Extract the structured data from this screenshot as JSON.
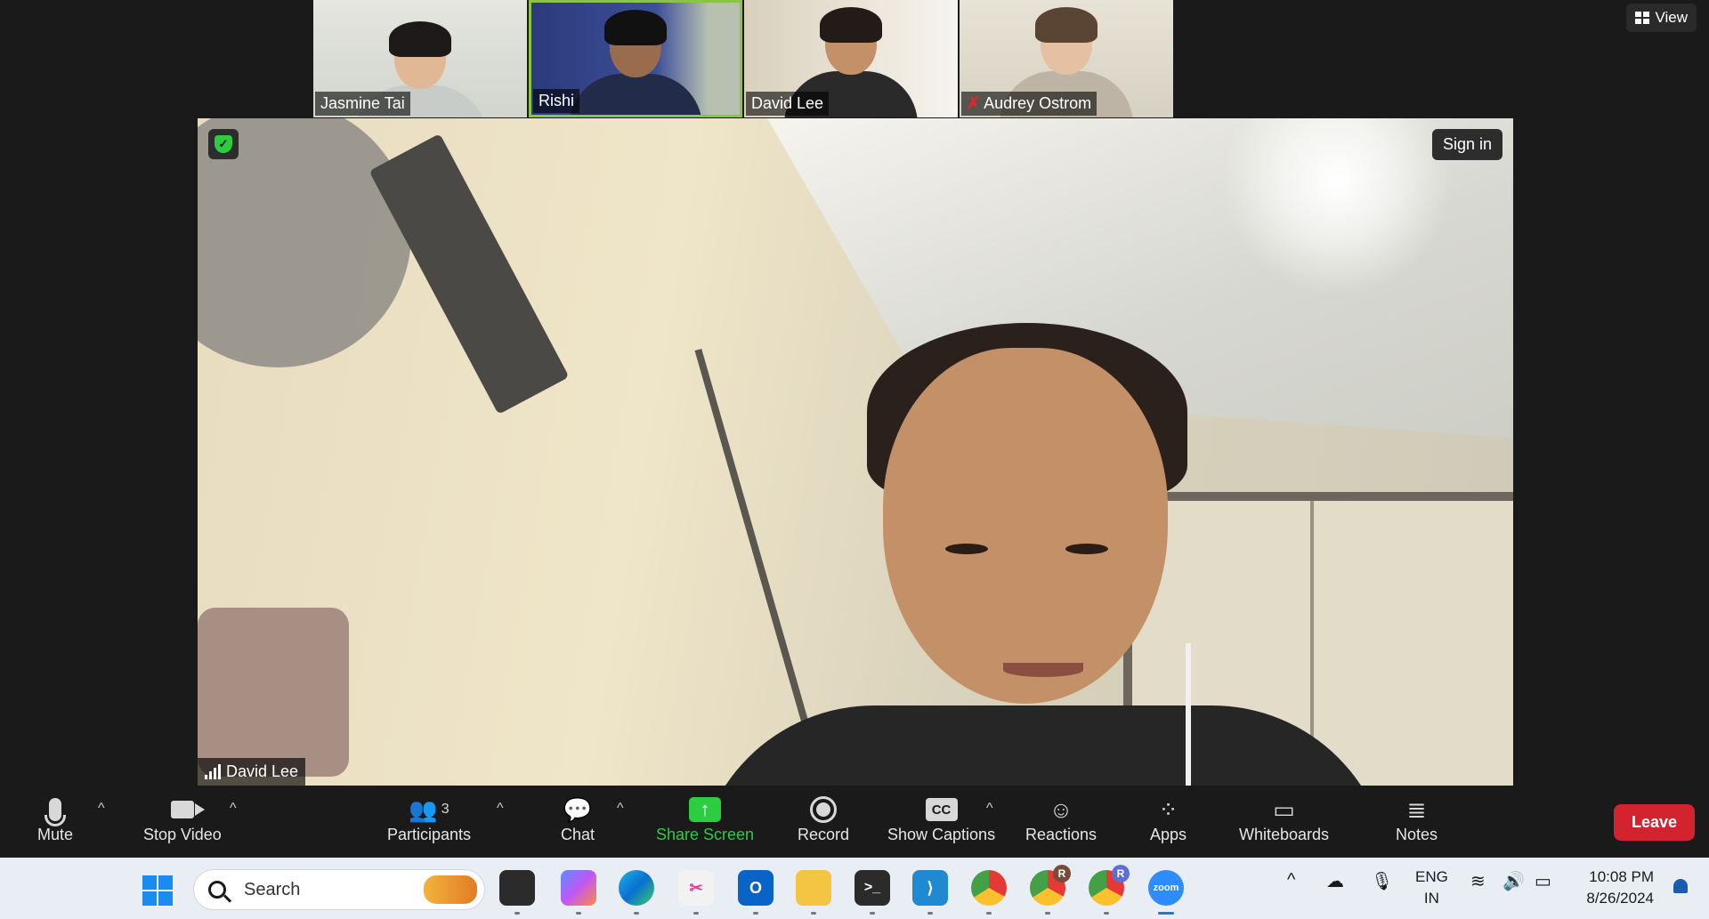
{
  "view_button": {
    "label": "View"
  },
  "participants_strip": [
    {
      "name": "Jasmine Tai",
      "muted": false,
      "active": false
    },
    {
      "name": "Rishi",
      "muted": false,
      "active": true
    },
    {
      "name": "David Lee",
      "muted": false,
      "active": false
    },
    {
      "name": "Audrey Ostrom",
      "muted": true,
      "active": false
    }
  ],
  "main_video": {
    "speaker_name": "David Lee",
    "sign_in_label": "Sign in"
  },
  "toolbar": {
    "mute": "Mute",
    "stop_video": "Stop Video",
    "participants": "Participants",
    "participants_count": "3",
    "chat": "Chat",
    "share_screen": "Share Screen",
    "record": "Record",
    "show_captions": "Show Captions",
    "captions_icon_text": "CC",
    "reactions": "Reactions",
    "apps": "Apps",
    "whiteboards": "Whiteboards",
    "notes": "Notes",
    "leave": "Leave"
  },
  "taskbar": {
    "search_placeholder": "Search",
    "zoom_label": "zoom",
    "lang_line1": "ENG",
    "lang_line2": "IN",
    "time": "10:08 PM",
    "date": "8/26/2024",
    "chrome_profile_1": "R",
    "chrome_profile_2": "R"
  },
  "colors": {
    "accent_green": "#2ecc40",
    "leave_red": "#d3232f",
    "active_border": "#8bc34a"
  }
}
